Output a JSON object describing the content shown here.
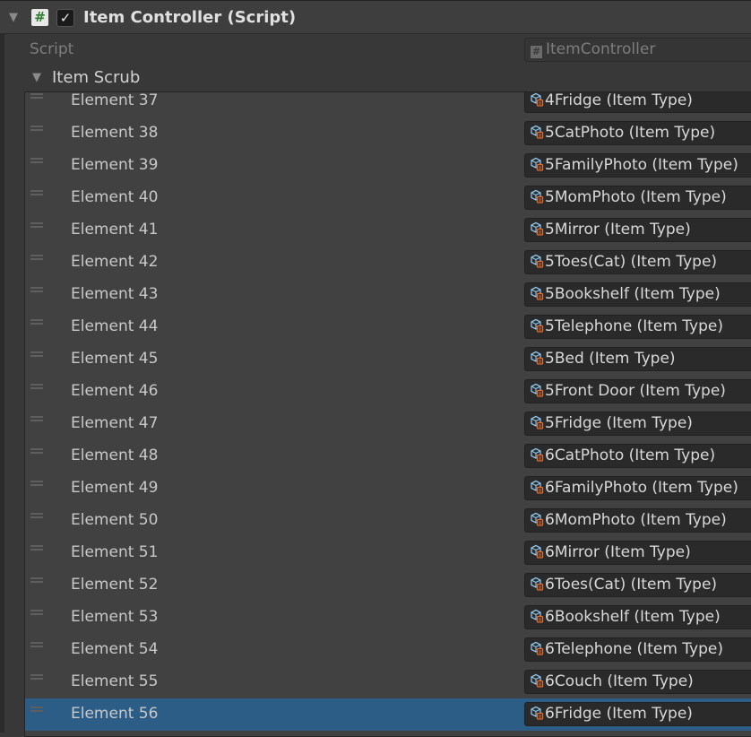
{
  "component": {
    "fold_arrow": "▼",
    "script_icon": "#",
    "checkbox": "✓",
    "title": "Item Controller (Script)"
  },
  "script_row": {
    "label": "Script",
    "icon": "#",
    "value": "ItemController"
  },
  "list": {
    "arrow": "▼",
    "label": "Item Scrub",
    "selected_index": 19,
    "items": [
      {
        "label": "Element 37",
        "value": "4Fridge (Item Type)"
      },
      {
        "label": "Element 38",
        "value": "5CatPhoto (Item Type)"
      },
      {
        "label": "Element 39",
        "value": "5FamilyPhoto (Item Type)"
      },
      {
        "label": "Element 40",
        "value": "5MomPhoto (Item Type)"
      },
      {
        "label": "Element 41",
        "value": "5Mirror (Item Type)"
      },
      {
        "label": "Element 42",
        "value": "5Toes(Cat) (Item Type)"
      },
      {
        "label": "Element 43",
        "value": "5Bookshelf (Item Type)"
      },
      {
        "label": "Element 44",
        "value": "5Telephone (Item Type)"
      },
      {
        "label": "Element 45",
        "value": "5Bed (Item Type)"
      },
      {
        "label": "Element 46",
        "value": "5Front Door (Item Type)"
      },
      {
        "label": "Element 47",
        "value": "5Fridge (Item Type)"
      },
      {
        "label": "Element 48",
        "value": "6CatPhoto (Item Type)"
      },
      {
        "label": "Element 49",
        "value": "6FamilyPhoto (Item Type)"
      },
      {
        "label": "Element 50",
        "value": "6MomPhoto (Item Type)"
      },
      {
        "label": "Element 51",
        "value": "6Mirror (Item Type)"
      },
      {
        "label": "Element 52",
        "value": "6Toes(Cat) (Item Type)"
      },
      {
        "label": "Element 53",
        "value": "6Bookshelf (Item Type)"
      },
      {
        "label": "Element 54",
        "value": "6Telephone (Item Type)"
      },
      {
        "label": "Element 55",
        "value": "6Couch (Item Type)"
      },
      {
        "label": "Element 56",
        "value": "6Fridge (Item Type)"
      }
    ]
  },
  "icons": {
    "script": "script-icon",
    "scriptable_object": "scriptable-object-icon",
    "drag": "drag-handle-icon"
  },
  "colors": {
    "selection": "#2c5d87",
    "panel": "#383838",
    "list_bg": "#414141",
    "field_bg": "#2a2a2a"
  }
}
